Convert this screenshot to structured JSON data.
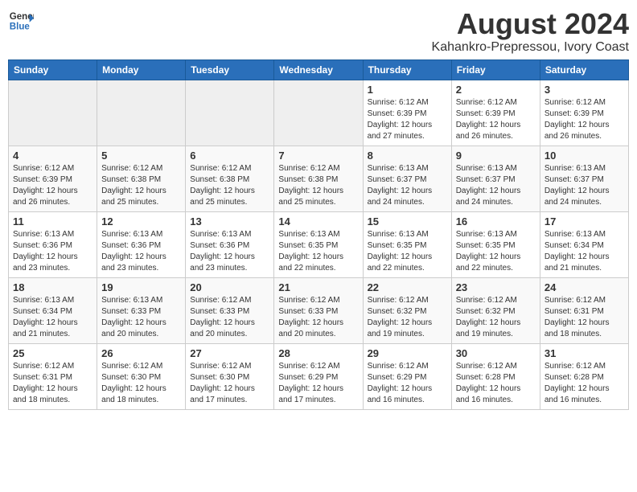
{
  "logo": {
    "general": "General",
    "blue": "Blue"
  },
  "header": {
    "title": "August 2024",
    "subtitle": "Kahankro-Prepressou, Ivory Coast"
  },
  "weekdays": [
    "Sunday",
    "Monday",
    "Tuesday",
    "Wednesday",
    "Thursday",
    "Friday",
    "Saturday"
  ],
  "weeks": [
    [
      {
        "day": "",
        "info": ""
      },
      {
        "day": "",
        "info": ""
      },
      {
        "day": "",
        "info": ""
      },
      {
        "day": "",
        "info": ""
      },
      {
        "day": "1",
        "info": "Sunrise: 6:12 AM\nSunset: 6:39 PM\nDaylight: 12 hours\nand 27 minutes."
      },
      {
        "day": "2",
        "info": "Sunrise: 6:12 AM\nSunset: 6:39 PM\nDaylight: 12 hours\nand 26 minutes."
      },
      {
        "day": "3",
        "info": "Sunrise: 6:12 AM\nSunset: 6:39 PM\nDaylight: 12 hours\nand 26 minutes."
      }
    ],
    [
      {
        "day": "4",
        "info": "Sunrise: 6:12 AM\nSunset: 6:39 PM\nDaylight: 12 hours\nand 26 minutes."
      },
      {
        "day": "5",
        "info": "Sunrise: 6:12 AM\nSunset: 6:38 PM\nDaylight: 12 hours\nand 25 minutes."
      },
      {
        "day": "6",
        "info": "Sunrise: 6:12 AM\nSunset: 6:38 PM\nDaylight: 12 hours\nand 25 minutes."
      },
      {
        "day": "7",
        "info": "Sunrise: 6:12 AM\nSunset: 6:38 PM\nDaylight: 12 hours\nand 25 minutes."
      },
      {
        "day": "8",
        "info": "Sunrise: 6:13 AM\nSunset: 6:37 PM\nDaylight: 12 hours\nand 24 minutes."
      },
      {
        "day": "9",
        "info": "Sunrise: 6:13 AM\nSunset: 6:37 PM\nDaylight: 12 hours\nand 24 minutes."
      },
      {
        "day": "10",
        "info": "Sunrise: 6:13 AM\nSunset: 6:37 PM\nDaylight: 12 hours\nand 24 minutes."
      }
    ],
    [
      {
        "day": "11",
        "info": "Sunrise: 6:13 AM\nSunset: 6:36 PM\nDaylight: 12 hours\nand 23 minutes."
      },
      {
        "day": "12",
        "info": "Sunrise: 6:13 AM\nSunset: 6:36 PM\nDaylight: 12 hours\nand 23 minutes."
      },
      {
        "day": "13",
        "info": "Sunrise: 6:13 AM\nSunset: 6:36 PM\nDaylight: 12 hours\nand 23 minutes."
      },
      {
        "day": "14",
        "info": "Sunrise: 6:13 AM\nSunset: 6:35 PM\nDaylight: 12 hours\nand 22 minutes."
      },
      {
        "day": "15",
        "info": "Sunrise: 6:13 AM\nSunset: 6:35 PM\nDaylight: 12 hours\nand 22 minutes."
      },
      {
        "day": "16",
        "info": "Sunrise: 6:13 AM\nSunset: 6:35 PM\nDaylight: 12 hours\nand 22 minutes."
      },
      {
        "day": "17",
        "info": "Sunrise: 6:13 AM\nSunset: 6:34 PM\nDaylight: 12 hours\nand 21 minutes."
      }
    ],
    [
      {
        "day": "18",
        "info": "Sunrise: 6:13 AM\nSunset: 6:34 PM\nDaylight: 12 hours\nand 21 minutes."
      },
      {
        "day": "19",
        "info": "Sunrise: 6:13 AM\nSunset: 6:33 PM\nDaylight: 12 hours\nand 20 minutes."
      },
      {
        "day": "20",
        "info": "Sunrise: 6:12 AM\nSunset: 6:33 PM\nDaylight: 12 hours\nand 20 minutes."
      },
      {
        "day": "21",
        "info": "Sunrise: 6:12 AM\nSunset: 6:33 PM\nDaylight: 12 hours\nand 20 minutes."
      },
      {
        "day": "22",
        "info": "Sunrise: 6:12 AM\nSunset: 6:32 PM\nDaylight: 12 hours\nand 19 minutes."
      },
      {
        "day": "23",
        "info": "Sunrise: 6:12 AM\nSunset: 6:32 PM\nDaylight: 12 hours\nand 19 minutes."
      },
      {
        "day": "24",
        "info": "Sunrise: 6:12 AM\nSunset: 6:31 PM\nDaylight: 12 hours\nand 18 minutes."
      }
    ],
    [
      {
        "day": "25",
        "info": "Sunrise: 6:12 AM\nSunset: 6:31 PM\nDaylight: 12 hours\nand 18 minutes."
      },
      {
        "day": "26",
        "info": "Sunrise: 6:12 AM\nSunset: 6:30 PM\nDaylight: 12 hours\nand 18 minutes."
      },
      {
        "day": "27",
        "info": "Sunrise: 6:12 AM\nSunset: 6:30 PM\nDaylight: 12 hours\nand 17 minutes."
      },
      {
        "day": "28",
        "info": "Sunrise: 6:12 AM\nSunset: 6:29 PM\nDaylight: 12 hours\nand 17 minutes."
      },
      {
        "day": "29",
        "info": "Sunrise: 6:12 AM\nSunset: 6:29 PM\nDaylight: 12 hours\nand 16 minutes."
      },
      {
        "day": "30",
        "info": "Sunrise: 6:12 AM\nSunset: 6:28 PM\nDaylight: 12 hours\nand 16 minutes."
      },
      {
        "day": "31",
        "info": "Sunrise: 6:12 AM\nSunset: 6:28 PM\nDaylight: 12 hours\nand 16 minutes."
      }
    ]
  ]
}
